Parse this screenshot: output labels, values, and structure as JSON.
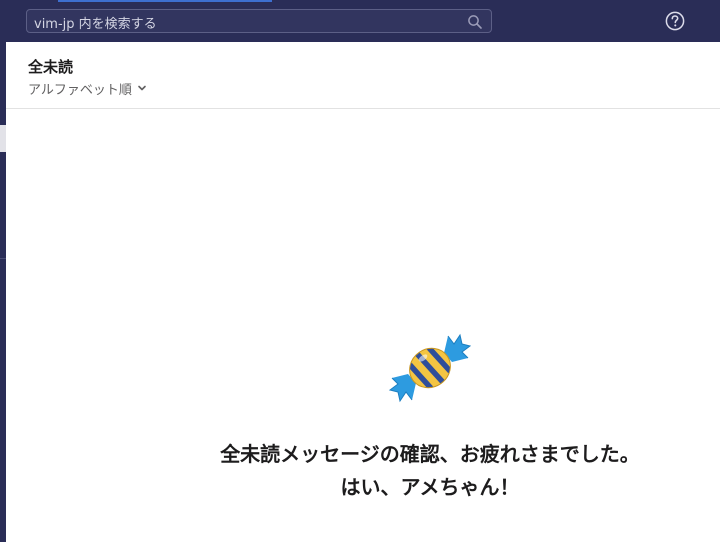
{
  "search": {
    "placeholder": "vim-jp 内を検索する"
  },
  "header": {
    "title": "全未読",
    "sort_label": "アルファベット順"
  },
  "empty_state": {
    "line1": "全未読メッセージの確認、お疲れさまでした。",
    "line2": "はい、アメちゃん！",
    "illustration": "candy-icon"
  },
  "icons": {
    "search": "search-icon",
    "help": "help-icon",
    "sort": "chevron-down-icon"
  },
  "colors": {
    "topbar": "#2a2d57",
    "accent": "#3d6fd0",
    "candy_wrapper": "#2d9be0",
    "candy_yellow": "#f4c542",
    "candy_stripe": "#2f4e9a"
  }
}
